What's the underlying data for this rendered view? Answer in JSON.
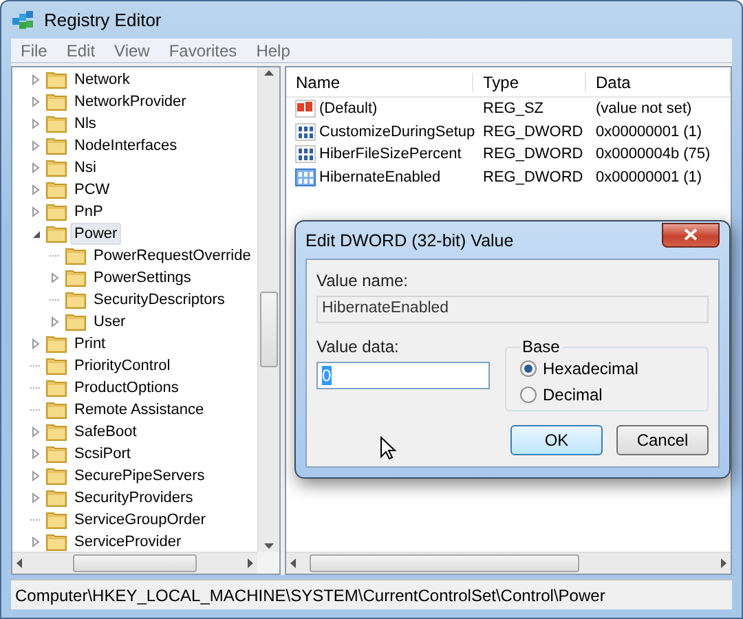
{
  "window": {
    "title": "Registry Editor"
  },
  "menu": [
    "File",
    "Edit",
    "View",
    "Favorites",
    "Help"
  ],
  "tree": {
    "items": [
      {
        "name": "Network",
        "expandable": true,
        "expanded": false,
        "selected": false
      },
      {
        "name": "NetworkProvider",
        "expandable": true,
        "expanded": false,
        "selected": false
      },
      {
        "name": "Nls",
        "expandable": true,
        "expanded": false,
        "selected": false
      },
      {
        "name": "NodeInterfaces",
        "expandable": true,
        "expanded": false,
        "selected": false
      },
      {
        "name": "Nsi",
        "expandable": true,
        "expanded": false,
        "selected": false
      },
      {
        "name": "PCW",
        "expandable": true,
        "expanded": false,
        "selected": false
      },
      {
        "name": "PnP",
        "expandable": true,
        "expanded": false,
        "selected": false
      },
      {
        "name": "Power",
        "expandable": true,
        "expanded": true,
        "selected": true,
        "children": [
          {
            "name": "PowerRequestOverride",
            "expandable": false,
            "selected": false
          },
          {
            "name": "PowerSettings",
            "expandable": true,
            "expanded": false,
            "selected": false
          },
          {
            "name": "SecurityDescriptors",
            "expandable": false,
            "selected": false
          },
          {
            "name": "User",
            "expandable": true,
            "expanded": false,
            "selected": false
          }
        ]
      },
      {
        "name": "Print",
        "expandable": true,
        "expanded": false,
        "selected": false
      },
      {
        "name": "PriorityControl",
        "expandable": false,
        "selected": false
      },
      {
        "name": "ProductOptions",
        "expandable": false,
        "selected": false
      },
      {
        "name": "Remote Assistance",
        "expandable": false,
        "selected": false
      },
      {
        "name": "SafeBoot",
        "expandable": true,
        "expanded": false,
        "selected": false
      },
      {
        "name": "ScsiPort",
        "expandable": true,
        "expanded": false,
        "selected": false
      },
      {
        "name": "SecurePipeServers",
        "expandable": true,
        "expanded": false,
        "selected": false
      },
      {
        "name": "SecurityProviders",
        "expandable": true,
        "expanded": false,
        "selected": false
      },
      {
        "name": "ServiceGroupOrder",
        "expandable": false,
        "selected": false
      },
      {
        "name": "ServiceProvider",
        "expandable": true,
        "expanded": false,
        "selected": false
      }
    ]
  },
  "values": {
    "columns": [
      "Name",
      "Type",
      "Data"
    ],
    "rows": [
      {
        "kind": "string",
        "name": "(Default)",
        "type": "REG_SZ",
        "data": "(value not set)",
        "selected": false
      },
      {
        "kind": "dword",
        "name": "CustomizeDuringSetup",
        "type": "REG_DWORD",
        "data": "0x00000001 (1)",
        "selected": false
      },
      {
        "kind": "dword",
        "name": "HiberFileSizePercent",
        "type": "REG_DWORD",
        "data": "0x0000004b (75)",
        "selected": false
      },
      {
        "kind": "dword",
        "name": "HibernateEnabled",
        "type": "REG_DWORD",
        "data": "0x00000001 (1)",
        "selected": true
      }
    ]
  },
  "dialog": {
    "title": "Edit DWORD (32-bit) Value",
    "value_name_label": "Value name:",
    "value_name": "HibernateEnabled",
    "value_data_label": "Value data:",
    "value_data": "0",
    "base_label": "Base",
    "base_options": [
      {
        "label": "Hexadecimal",
        "selected": true
      },
      {
        "label": "Decimal",
        "selected": false
      }
    ],
    "buttons": [
      "OK",
      "Cancel"
    ]
  },
  "status_bar": "Computer\\HKEY_LOCAL_MACHINE\\SYSTEM\\CurrentControlSet\\Control\\Power"
}
